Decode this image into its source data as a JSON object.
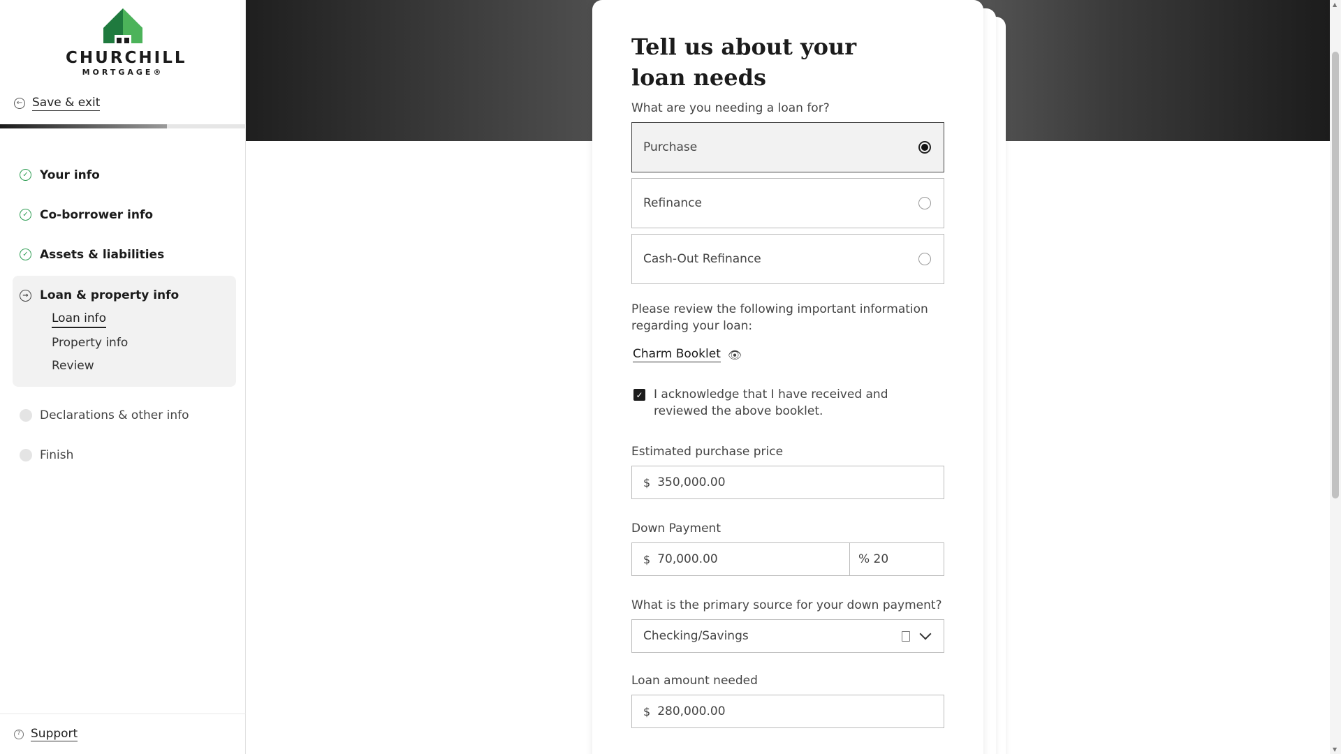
{
  "sidebar": {
    "logo_text": "CHURCHILL",
    "logo_sub": "MORTGAGE®",
    "save_exit": "Save & exit",
    "progress_fraction": 0.68,
    "completed": [
      {
        "label": "Your info"
      },
      {
        "label": "Co-borrower info"
      },
      {
        "label": "Assets & liabilities"
      }
    ],
    "current": {
      "label": "Loan & property info",
      "subitems": [
        "Loan info",
        "Property info",
        "Review"
      ]
    },
    "pending": [
      {
        "label": "Declarations & other info"
      },
      {
        "label": "Finish"
      }
    ],
    "support": "Support"
  },
  "form": {
    "title": "Tell us about your loan needs",
    "loan_purpose_label": "What are you needing a loan for?",
    "options": [
      "Purchase",
      "Refinance",
      "Cash-Out Refinance"
    ],
    "selected_option": "Purchase",
    "review_text": "Please review the following important information regarding your loan:",
    "booklet_link": "Charm Booklet",
    "acknowledge_text": "I acknowledge that I have received and reviewed the above booklet.",
    "acknowledge_checked": true,
    "price_label": "Estimated purchase price",
    "currency_symbol": "$",
    "price_value": "350,000.00",
    "down_payment_label": "Down Payment",
    "down_payment_value": "70,000.00",
    "down_payment_percent": "% 20",
    "source_label": "What is the primary source for your down payment?",
    "source_value": "Checking/Savings",
    "loan_amount_label": "Loan amount needed",
    "loan_amount_value": "280,000.00"
  },
  "colors": {
    "check_green": "#2e9d53",
    "logo_green_dark": "#1f7a3e",
    "logo_green_light": "#4cb35a"
  }
}
